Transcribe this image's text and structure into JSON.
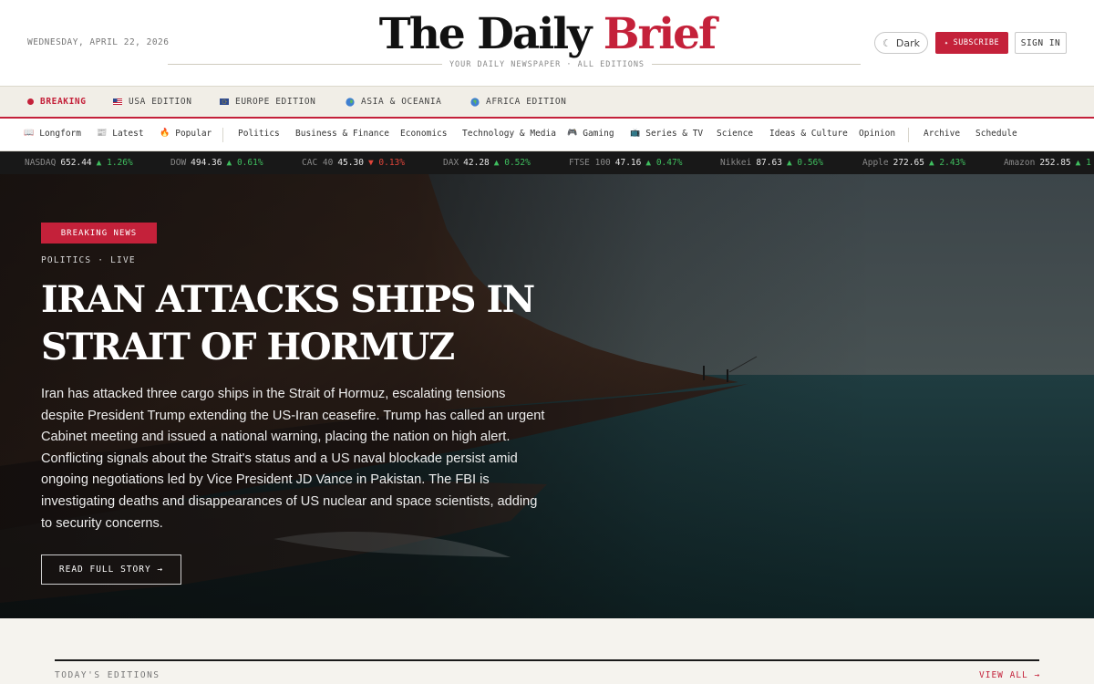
{
  "masthead": {
    "date": "WEDNESDAY, APRIL 22, 2026",
    "logo_main": "The Daily ",
    "logo_accent": "Brief",
    "tagline": "YOUR DAILY NEWSPAPER · ALL EDITIONS",
    "dark_label": "Dark",
    "subscribe_label": "SUBSCRIBE",
    "signin_label": "SIGN IN",
    "accent_color": "#c4213a"
  },
  "editions": [
    {
      "label": "BREAKING",
      "icon": "live-dot-icon"
    },
    {
      "label": "USA EDITION",
      "icon": "us-flag-icon"
    },
    {
      "label": "EUROPE EDITION",
      "icon": "eu-flag-icon"
    },
    {
      "label": "ASIA & OCEANIA",
      "icon": "globe-asia-icon"
    },
    {
      "label": "AFRICA EDITION",
      "icon": "globe-africa-icon"
    }
  ],
  "nav": [
    {
      "label": "Longform",
      "icon": "book-icon"
    },
    {
      "label": "Latest",
      "icon": "newspaper-icon"
    },
    {
      "label": "Popular",
      "icon": "fire-icon"
    },
    {
      "label": "Politics"
    },
    {
      "label": "Business & Finance"
    },
    {
      "label": "Economics"
    },
    {
      "label": "Technology & Media"
    },
    {
      "label": "Gaming",
      "icon": "gamepad-icon"
    },
    {
      "label": "Series & TV",
      "icon": "tv-icon"
    },
    {
      "label": "Science"
    },
    {
      "label": "Ideas & Culture"
    },
    {
      "label": "Opinion"
    },
    {
      "label": "Archive"
    },
    {
      "label": "Schedule"
    }
  ],
  "ticker": [
    {
      "name": "NASDAQ",
      "value": "652.44",
      "change": "▲ 1.26%",
      "dir": "up"
    },
    {
      "name": "DOW",
      "value": "494.36",
      "change": "▲ 0.61%",
      "dir": "up"
    },
    {
      "name": "CAC 40",
      "value": "45.30",
      "change": "▼ 0.13%",
      "dir": "down"
    },
    {
      "name": "DAX",
      "value": "42.28",
      "change": "▲ 0.52%",
      "dir": "up"
    },
    {
      "name": "FTSE 100",
      "value": "47.16",
      "change": "▲ 0.47%",
      "dir": "up"
    },
    {
      "name": "Nikkei",
      "value": "87.63",
      "change": "▲ 0.56%",
      "dir": "up"
    },
    {
      "name": "Apple",
      "value": "272.65",
      "change": "▲ 2.43%",
      "dir": "up"
    },
    {
      "name": "Amazon",
      "value": "252.85",
      "change": "▲ 1",
      "dir": "up"
    }
  ],
  "hero": {
    "badge": "BREAKING NEWS",
    "kicker": "POLITICS · LIVE",
    "headline_line1": "IRAN ATTACKS SHIPS IN",
    "headline_line2": "STRAIT OF HORMUZ",
    "summary": "Iran has attacked three cargo ships in the Strait of Hormuz, escalating tensions despite President Trump extending the US-Iran ceasefire. Trump has called an urgent Cabinet meeting and issued a national warning, placing the nation on high alert. Conflicting signals about the Strait's status and a US naval blockade persist amid ongoing negotiations led by Vice President JD Vance in Pakistan. The FBI is investigating deaths and disappearances of US nuclear and space scientists, adding to security concerns.",
    "cta": "READ FULL STORY →"
  },
  "editions_section": {
    "label": "TODAY'S EDITIONS",
    "view_all": "VIEW ALL →"
  }
}
